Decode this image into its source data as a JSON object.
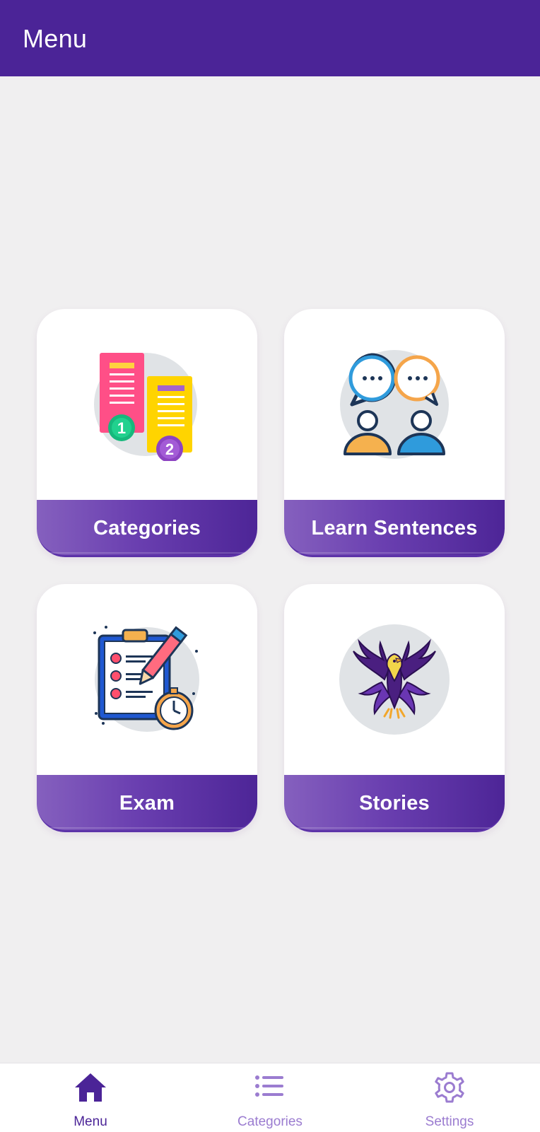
{
  "app_bar": {
    "title": "Menu"
  },
  "cards": [
    {
      "label": "Categories",
      "icon": "numbered-lists-icon"
    },
    {
      "label": "Learn Sentences",
      "icon": "conversation-icon"
    },
    {
      "label": "Exam",
      "icon": "clipboard-checklist-icon"
    },
    {
      "label": "Stories",
      "icon": "phoenix-icon"
    }
  ],
  "bottom_nav": {
    "items": [
      {
        "label": "Menu",
        "icon": "home-icon",
        "active": true
      },
      {
        "label": "Categories",
        "icon": "list-icon",
        "active": false
      },
      {
        "label": "Settings",
        "icon": "gear-icon",
        "active": false
      }
    ]
  },
  "colors": {
    "primary": "#4b2497",
    "card_footer_start": "#8560be",
    "card_footer_end": "#4d2597",
    "inactive_nav": "#9b7cd0",
    "background": "#f0eff0"
  }
}
